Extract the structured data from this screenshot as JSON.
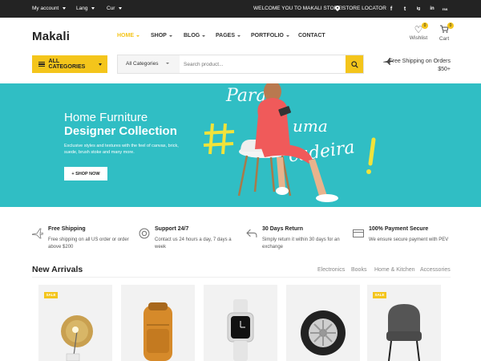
{
  "topbar": {
    "account": "My account",
    "lang": "Lang",
    "currency": "Cur",
    "welcome": "WELCOME YOU TO MAKALI STORE!",
    "store_locator": "STORE LOCATOR",
    "social": [
      "f",
      "t",
      "ig",
      "in",
      "rss"
    ]
  },
  "header": {
    "logo": "Makali",
    "nav": [
      "HOME",
      "SHOP",
      "BLOG",
      "PAGES",
      "PORTFOLIO",
      "CONTACT"
    ],
    "wishlist": {
      "label": "Wishlist",
      "count": "0"
    },
    "cart": {
      "label": "Cart",
      "count": "0"
    }
  },
  "search": {
    "category_button": "ALL CATEGORIES",
    "category_select": "All Categories",
    "placeholder": "Search product..."
  },
  "shipping_promo": {
    "line1": "Free Shipping on Orders",
    "line2": "$50+"
  },
  "hero": {
    "title": "Home Furniture",
    "subtitle": "Designer Collection",
    "description": "Exclusive styles and textures with the feel of canvas, brick, suede, brush stoke and many more.",
    "button": "+ SHOP NOW",
    "script_text_1": "Para",
    "script_text_2": "uma",
    "script_text_3": "cadeira"
  },
  "features": [
    {
      "title": "Free Shipping",
      "desc": "Free shipping on all US order or order above $200",
      "icon": "plane-icon"
    },
    {
      "title": "Support 24/7",
      "desc": "Contact us 24 hours a day, 7 days a week",
      "icon": "lifebuoy-icon"
    },
    {
      "title": "30 Days Return",
      "desc": "Simply return it within 30 days for an exchange",
      "icon": "return-icon"
    },
    {
      "title": "100% Payment Secure",
      "desc": "We ensure secure payment with PEV",
      "icon": "card-icon"
    }
  ],
  "arrivals": {
    "title": "New Arrivals",
    "tabs": [
      "Electronics",
      "Books",
      "Home & Kitchen",
      "Accessories"
    ]
  },
  "products": [
    {
      "name": "lamp",
      "badge": "SALE"
    },
    {
      "name": "backpack",
      "badge": ""
    },
    {
      "name": "watch",
      "badge": ""
    },
    {
      "name": "tire",
      "badge": ""
    },
    {
      "name": "chair",
      "badge": "SALE"
    }
  ],
  "colors": {
    "accent": "#f4c51b",
    "hero_bg": "#30bec4",
    "topbar_bg": "#232323"
  }
}
